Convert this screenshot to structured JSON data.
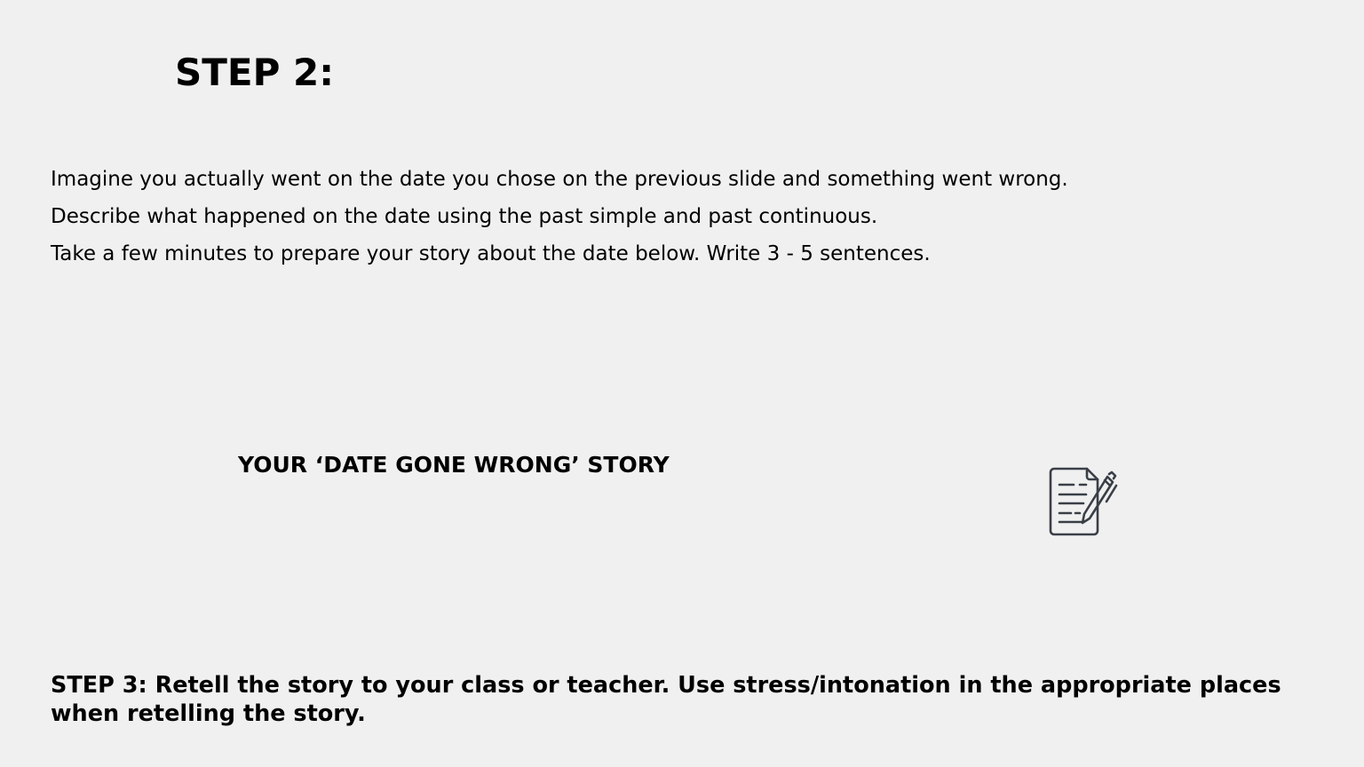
{
  "step2": {
    "title": "STEP 2:"
  },
  "instructions": [
    "Imagine you actually went on the date you chose on the previous slide and something went wrong.",
    "Describe what happened on the date using the past simple and past continuous.",
    "Take a few minutes to prepare your story about the date below. Write 3 - 5 sentences."
  ],
  "story": {
    "heading": "YOUR ‘DATE GONE WRONG’ STORY",
    "icon": "document-with-pen-icon",
    "icon_color": "#3a3f47"
  },
  "step3": {
    "text": "STEP 3: Retell the story to your class or teacher. Use stress/intonation in the appropriate places when retelling the story."
  }
}
